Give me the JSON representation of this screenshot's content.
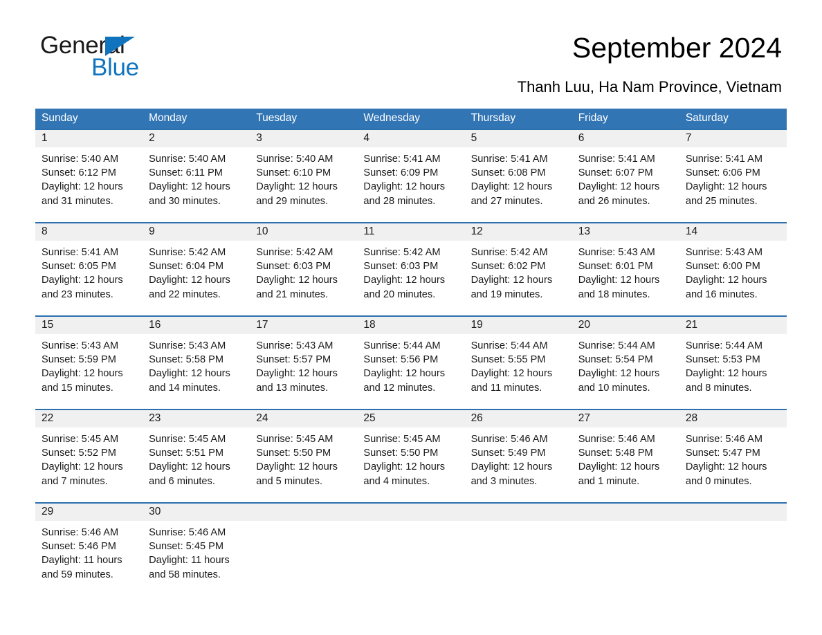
{
  "logo": {
    "text_primary": "General",
    "text_secondary": "Blue",
    "triangle_color": "#1073bd"
  },
  "header": {
    "title": "September 2024",
    "subtitle": "Thanh Luu, Ha Nam Province, Vietnam"
  },
  "theme": {
    "header_blue": "#3275b5",
    "row_border_blue": "#2b6fae",
    "daynum_band": "#f0f0f0",
    "text": "#1a1a1a",
    "header_text": "#ffffff"
  },
  "weekdays": [
    "Sunday",
    "Monday",
    "Tuesday",
    "Wednesday",
    "Thursday",
    "Friday",
    "Saturday"
  ],
  "labels": {
    "sunrise_prefix": "Sunrise:",
    "sunset_prefix": "Sunset:",
    "daylight_prefix": "Daylight:"
  },
  "weeks": [
    [
      {
        "day": "1",
        "l1": "Sunrise: 5:40 AM",
        "l2": "Sunset: 6:12 PM",
        "l3": "Daylight: 12 hours",
        "l4": "and 31 minutes."
      },
      {
        "day": "2",
        "l1": "Sunrise: 5:40 AM",
        "l2": "Sunset: 6:11 PM",
        "l3": "Daylight: 12 hours",
        "l4": "and 30 minutes."
      },
      {
        "day": "3",
        "l1": "Sunrise: 5:40 AM",
        "l2": "Sunset: 6:10 PM",
        "l3": "Daylight: 12 hours",
        "l4": "and 29 minutes."
      },
      {
        "day": "4",
        "l1": "Sunrise: 5:41 AM",
        "l2": "Sunset: 6:09 PM",
        "l3": "Daylight: 12 hours",
        "l4": "and 28 minutes."
      },
      {
        "day": "5",
        "l1": "Sunrise: 5:41 AM",
        "l2": "Sunset: 6:08 PM",
        "l3": "Daylight: 12 hours",
        "l4": "and 27 minutes."
      },
      {
        "day": "6",
        "l1": "Sunrise: 5:41 AM",
        "l2": "Sunset: 6:07 PM",
        "l3": "Daylight: 12 hours",
        "l4": "and 26 minutes."
      },
      {
        "day": "7",
        "l1": "Sunrise: 5:41 AM",
        "l2": "Sunset: 6:06 PM",
        "l3": "Daylight: 12 hours",
        "l4": "and 25 minutes."
      }
    ],
    [
      {
        "day": "8",
        "l1": "Sunrise: 5:41 AM",
        "l2": "Sunset: 6:05 PM",
        "l3": "Daylight: 12 hours",
        "l4": "and 23 minutes."
      },
      {
        "day": "9",
        "l1": "Sunrise: 5:42 AM",
        "l2": "Sunset: 6:04 PM",
        "l3": "Daylight: 12 hours",
        "l4": "and 22 minutes."
      },
      {
        "day": "10",
        "l1": "Sunrise: 5:42 AM",
        "l2": "Sunset: 6:03 PM",
        "l3": "Daylight: 12 hours",
        "l4": "and 21 minutes."
      },
      {
        "day": "11",
        "l1": "Sunrise: 5:42 AM",
        "l2": "Sunset: 6:03 PM",
        "l3": "Daylight: 12 hours",
        "l4": "and 20 minutes."
      },
      {
        "day": "12",
        "l1": "Sunrise: 5:42 AM",
        "l2": "Sunset: 6:02 PM",
        "l3": "Daylight: 12 hours",
        "l4": "and 19 minutes."
      },
      {
        "day": "13",
        "l1": "Sunrise: 5:43 AM",
        "l2": "Sunset: 6:01 PM",
        "l3": "Daylight: 12 hours",
        "l4": "and 18 minutes."
      },
      {
        "day": "14",
        "l1": "Sunrise: 5:43 AM",
        "l2": "Sunset: 6:00 PM",
        "l3": "Daylight: 12 hours",
        "l4": "and 16 minutes."
      }
    ],
    [
      {
        "day": "15",
        "l1": "Sunrise: 5:43 AM",
        "l2": "Sunset: 5:59 PM",
        "l3": "Daylight: 12 hours",
        "l4": "and 15 minutes."
      },
      {
        "day": "16",
        "l1": "Sunrise: 5:43 AM",
        "l2": "Sunset: 5:58 PM",
        "l3": "Daylight: 12 hours",
        "l4": "and 14 minutes."
      },
      {
        "day": "17",
        "l1": "Sunrise: 5:43 AM",
        "l2": "Sunset: 5:57 PM",
        "l3": "Daylight: 12 hours",
        "l4": "and 13 minutes."
      },
      {
        "day": "18",
        "l1": "Sunrise: 5:44 AM",
        "l2": "Sunset: 5:56 PM",
        "l3": "Daylight: 12 hours",
        "l4": "and 12 minutes."
      },
      {
        "day": "19",
        "l1": "Sunrise: 5:44 AM",
        "l2": "Sunset: 5:55 PM",
        "l3": "Daylight: 12 hours",
        "l4": "and 11 minutes."
      },
      {
        "day": "20",
        "l1": "Sunrise: 5:44 AM",
        "l2": "Sunset: 5:54 PM",
        "l3": "Daylight: 12 hours",
        "l4": "and 10 minutes."
      },
      {
        "day": "21",
        "l1": "Sunrise: 5:44 AM",
        "l2": "Sunset: 5:53 PM",
        "l3": "Daylight: 12 hours",
        "l4": "and 8 minutes."
      }
    ],
    [
      {
        "day": "22",
        "l1": "Sunrise: 5:45 AM",
        "l2": "Sunset: 5:52 PM",
        "l3": "Daylight: 12 hours",
        "l4": "and 7 minutes."
      },
      {
        "day": "23",
        "l1": "Sunrise: 5:45 AM",
        "l2": "Sunset: 5:51 PM",
        "l3": "Daylight: 12 hours",
        "l4": "and 6 minutes."
      },
      {
        "day": "24",
        "l1": "Sunrise: 5:45 AM",
        "l2": "Sunset: 5:50 PM",
        "l3": "Daylight: 12 hours",
        "l4": "and 5 minutes."
      },
      {
        "day": "25",
        "l1": "Sunrise: 5:45 AM",
        "l2": "Sunset: 5:50 PM",
        "l3": "Daylight: 12 hours",
        "l4": "and 4 minutes."
      },
      {
        "day": "26",
        "l1": "Sunrise: 5:46 AM",
        "l2": "Sunset: 5:49 PM",
        "l3": "Daylight: 12 hours",
        "l4": "and 3 minutes."
      },
      {
        "day": "27",
        "l1": "Sunrise: 5:46 AM",
        "l2": "Sunset: 5:48 PM",
        "l3": "Daylight: 12 hours",
        "l4": "and 1 minute."
      },
      {
        "day": "28",
        "l1": "Sunrise: 5:46 AM",
        "l2": "Sunset: 5:47 PM",
        "l3": "Daylight: 12 hours",
        "l4": "and 0 minutes."
      }
    ],
    [
      {
        "day": "29",
        "l1": "Sunrise: 5:46 AM",
        "l2": "Sunset: 5:46 PM",
        "l3": "Daylight: 11 hours",
        "l4": "and 59 minutes."
      },
      {
        "day": "30",
        "l1": "Sunrise: 5:46 AM",
        "l2": "Sunset: 5:45 PM",
        "l3": "Daylight: 11 hours",
        "l4": "and 58 minutes."
      },
      {
        "day": "",
        "l1": "",
        "l2": "",
        "l3": "",
        "l4": ""
      },
      {
        "day": "",
        "l1": "",
        "l2": "",
        "l3": "",
        "l4": ""
      },
      {
        "day": "",
        "l1": "",
        "l2": "",
        "l3": "",
        "l4": ""
      },
      {
        "day": "",
        "l1": "",
        "l2": "",
        "l3": "",
        "l4": ""
      },
      {
        "day": "",
        "l1": "",
        "l2": "",
        "l3": "",
        "l4": ""
      }
    ]
  ]
}
